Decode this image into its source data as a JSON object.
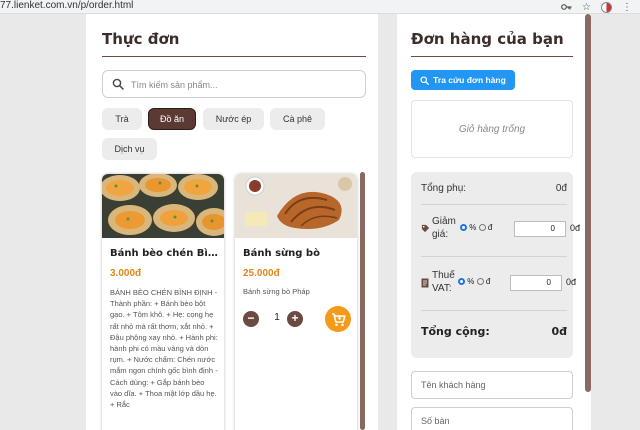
{
  "browser": {
    "url": "77.lienket.com.vn/p/order.html"
  },
  "menu": {
    "title": "Thực đơn",
    "search_placeholder": "Tìm kiếm sản phẩm...",
    "categories": [
      {
        "label": "Trà",
        "active": false
      },
      {
        "label": "Đồ ăn",
        "active": true
      },
      {
        "label": "Nước ép",
        "active": false
      },
      {
        "label": "Cà phê",
        "active": false
      },
      {
        "label": "Dịch vụ",
        "active": false
      }
    ],
    "products": [
      {
        "name": "Bánh bèo chén Bình Định",
        "price": "3.000đ",
        "description": "BÁNH BÈO CHÉN BÌNH ĐỊNH - Thành phần: + Bánh bèo bột gạo. + Tôm khô. + Hẹ: cọng hẹ rất nhỏ mà rất thơm, xắt nhỏ. + Đậu phộng xay nhỏ. + Hành phi: hành phi có màu vàng và dòn rụm. + Nước chấm: Chén nước mắm ngon chính gốc bình định - Cách dùng: + Gắp bánh bèo vào dĩa. + Thoa mật lớp dầu hẹ. + Rắc"
      },
      {
        "name": "Bánh sừng bò",
        "price": "25.000đ",
        "description": "Bánh sừng bò Pháp",
        "quantity": "1"
      }
    ]
  },
  "order": {
    "title": "Đơn hàng của bạn",
    "lookup_label": "Tra cứu đơn hàng",
    "empty_cart": "Giỏ hàng trống",
    "subtotal_label": "Tổng phụ:",
    "subtotal_value": "0đ",
    "discount_label_1": "Giảm",
    "discount_label_2": "giá:",
    "percent": "%",
    "dong": "đ",
    "discount_value": "0",
    "discount_unit": "0đ",
    "vat_label_1": "Thuế",
    "vat_label_2": "VAT:",
    "vat_value": "0",
    "vat_unit": "0đ",
    "total_label": "Tổng cộng:",
    "total_value": "0đ",
    "customer_placeholder": "Tên khách hàng",
    "table_placeholder": "Số bàn"
  },
  "colors": {
    "brand": "#5b3a33",
    "accent": "#f39a1b",
    "price": "#e0861a",
    "lookup": "#2196f3"
  }
}
